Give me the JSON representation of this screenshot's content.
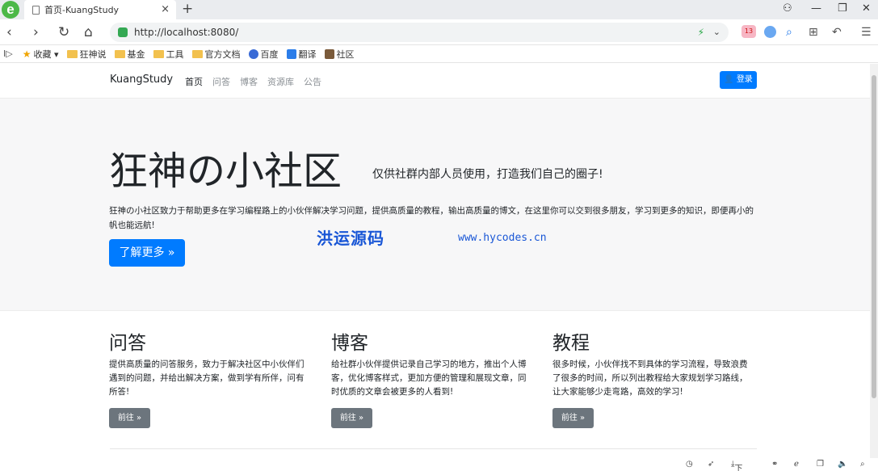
{
  "browser": {
    "tab_title": "首页-KuangStudy",
    "tab_close": "×",
    "new_tab": "+",
    "url": "http://localhost:8080/",
    "badge_count": "13",
    "nav": {
      "back": "‹",
      "forward": "›",
      "reload": "↻",
      "home": "⌂"
    },
    "window": {
      "shirt": "⚇",
      "minimize": "—",
      "restore": "❐",
      "close": "✕"
    },
    "tools": {
      "search": "⌕",
      "grid": "⊞",
      "undo": "↶",
      "menu": "☰"
    }
  },
  "bookmarks": {
    "toggle": "I▷",
    "items": [
      {
        "label": "收藏 ▾",
        "icon": "star"
      },
      {
        "label": "狂神说",
        "icon": "folder"
      },
      {
        "label": "基金",
        "icon": "folder"
      },
      {
        "label": "工具",
        "icon": "folder"
      },
      {
        "label": "官方文档",
        "icon": "folder"
      },
      {
        "label": "百度",
        "icon": "baidu"
      },
      {
        "label": "翻译",
        "icon": "translate"
      },
      {
        "label": "社区",
        "icon": "community"
      }
    ]
  },
  "site": {
    "brand": "KuangStudy",
    "menu": [
      "首页",
      "问答",
      "博客",
      "资源库",
      "公告"
    ],
    "login_label": "登录"
  },
  "hero": {
    "title": "狂神の小社区",
    "subtitle": "仅供社群内部人员使用，打造我们自己的圈子!",
    "description": "狂神の小社区致力于帮助更多在学习编程路上的小伙伴解决学习问题，提供高质量的教程，输出高质量的博文，在这里你可以交到很多朋友，学习到更多的知识，即便再小的帆也能远航!",
    "button_label": "了解更多 »"
  },
  "watermark": {
    "text": "洪运源码",
    "url": "www.hycodes.cn"
  },
  "cards": [
    {
      "title": "问答",
      "text": "提供高质量的问答服务，致力于解决社区中小伙伴们遇到的问题，并给出解决方案，做到学有所伴，问有所答!",
      "button": "前往 »"
    },
    {
      "title": "博客",
      "text": "给社群小伙伴提供记录自己学习的地方，推出个人博客，优化博客样式，更加方便的管理和展现文章，同时优质的文章会被更多的人看到!",
      "button": "前往 »"
    },
    {
      "title": "教程",
      "text": "很多时候，小伙伴找不到具体的学习流程，导致浪费了很多的时间，所以列出教程给大家规划学习路线，让大家能够少走弯路，高效的学习!",
      "button": "前往 »"
    }
  ],
  "statusbar": {
    "download": "下载"
  }
}
